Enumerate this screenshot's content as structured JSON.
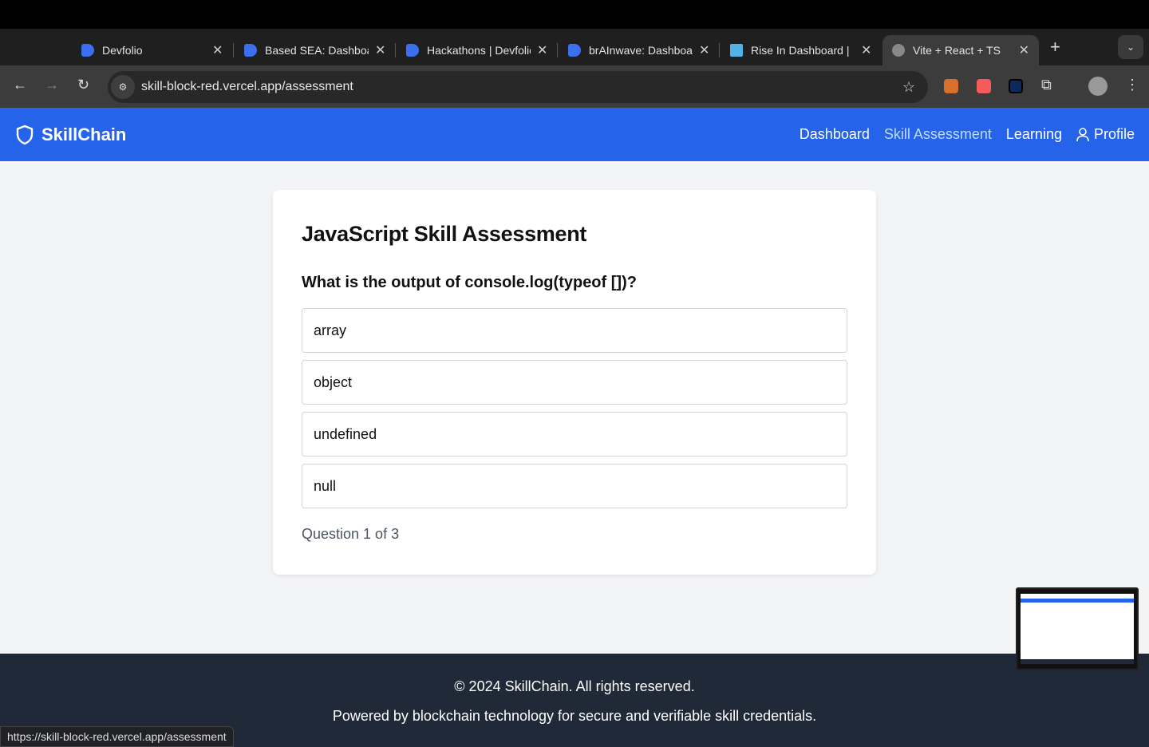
{
  "browser": {
    "tabs": [
      {
        "title": "Devfolio",
        "icon": "devfolio-icon"
      },
      {
        "title": "Based SEA: Dashboard",
        "icon": "devfolio-icon"
      },
      {
        "title": "Hackathons | Devfolio",
        "icon": "devfolio-icon"
      },
      {
        "title": "brAInwave: Dashboard",
        "icon": "devfolio-icon"
      },
      {
        "title": "Rise In Dashboard | ",
        "icon": "rise-in-icon"
      },
      {
        "title": "Vite + React + TS",
        "icon": "globe-icon",
        "active": true
      }
    ],
    "url": "skill-block-red.vercel.app/assessment",
    "status_url": "https://skill-block-red.vercel.app/assessment"
  },
  "nav": {
    "brand": "SkillChain",
    "links": [
      {
        "label": "Dashboard"
      },
      {
        "label": "Skill Assessment",
        "active": true
      },
      {
        "label": "Learning"
      },
      {
        "label": "Profile"
      }
    ]
  },
  "assessment": {
    "title": "JavaScript Skill Assessment",
    "question": "What is the output of console.log(typeof [])?",
    "options": [
      "array",
      "object",
      "undefined",
      "null"
    ],
    "progress": "Question 1 of 3"
  },
  "footer": {
    "copyright": "© 2024 SkillChain. All rights reserved.",
    "tagline": "Powered by blockchain technology for secure and verifiable skill credentials."
  },
  "colors": {
    "nav": "#2563eb",
    "footer": "#1f2937",
    "background": "#f3f4f6"
  }
}
